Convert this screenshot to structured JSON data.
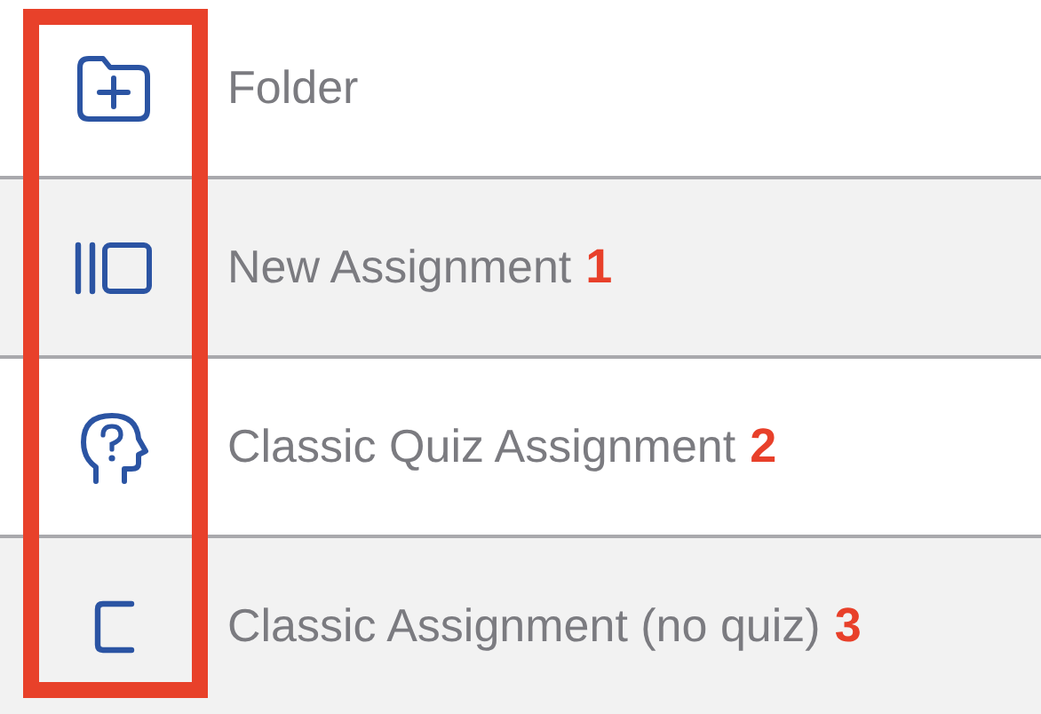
{
  "items": [
    {
      "kind": "folder",
      "label": "Folder"
    },
    {
      "kind": "assignment",
      "label": "New Assignment",
      "badge": "1"
    },
    {
      "kind": "quiz",
      "label": "Classic Quiz Assignment",
      "badge": "2"
    },
    {
      "kind": "classic",
      "label": "Classic Assignment (no quiz)",
      "badge": "3"
    }
  ],
  "icon_column_highlighted": true
}
